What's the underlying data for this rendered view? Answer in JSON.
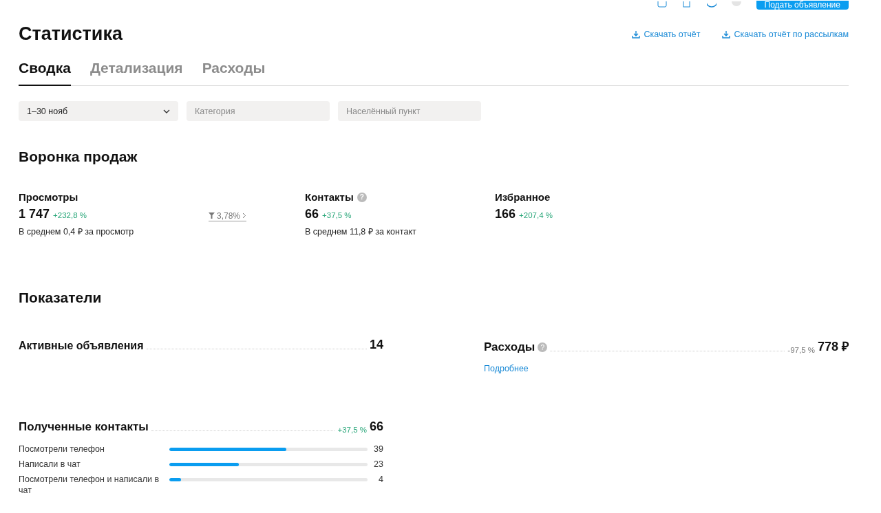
{
  "top_bar": {
    "post_button": "Подать объявление"
  },
  "header": {
    "title": "Статистика",
    "links": [
      "Скачать отчёт",
      "Скачать отчёт по рассылкам"
    ]
  },
  "tabs": [
    {
      "label": "Сводка",
      "selected": true
    },
    {
      "label": "Детализация",
      "selected": false
    },
    {
      "label": "Расходы",
      "selected": false
    }
  ],
  "filters": {
    "period": "1–30 нояб",
    "category_placeholder": "Категория",
    "city_placeholder": "Населённый пункт"
  },
  "funnel": {
    "title": "Воронка продаж",
    "conversion": "3,78%",
    "metrics": [
      {
        "label": "Просмотры",
        "value": "1 747",
        "change": "+232,8 %",
        "note": "В среднем 0,4 ₽ за просмотр"
      },
      {
        "label": "Контакты",
        "value": "66",
        "change": "+37,5 %",
        "note": "В среднем 11,8 ₽ за контакт",
        "help": "?"
      },
      {
        "label": "Избранное",
        "value": "166",
        "change": "+207,4 %"
      }
    ]
  },
  "indicators": {
    "title": "Показатели",
    "active_ads": {
      "label": "Активные объявления",
      "value": "14"
    },
    "expenses": {
      "label": "Расходы",
      "help": "?",
      "change": "-97,5 %",
      "value": "778 ₽",
      "link": "Подробнее"
    },
    "contacts": {
      "label": "Полученные контакты",
      "change": "+37,5 %",
      "value": "66",
      "rows": [
        {
          "label": "Посмотрели телефон",
          "level": 0.59,
          "value": "39"
        },
        {
          "label": "Написали в чат",
          "level": 0.35,
          "value": "23"
        },
        {
          "label": "Посмотрели телефон и написали в чат",
          "level": 0.06,
          "value": "4"
        }
      ]
    }
  }
}
